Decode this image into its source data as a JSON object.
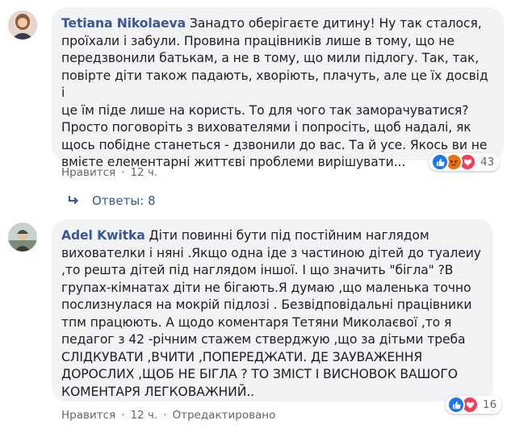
{
  "comments": [
    {
      "author": "Tetiana Nikolaeva",
      "lines": [
        "Занадто оберігаєте дитину! Ну так сталося,",
        "проїхали і забули. Провина працівників лише в тому, що не",
        "передзвонили батькам, а не в тому, що мили підлогу. Так, так,",
        "повірте діти також падають, хворіють, плачуть, але це їх досвід і",
        "це їм піде лише на користь. То для чого так заморачуватися?",
        "Просто поговоріть з вихователями і попросіть, щоб надалі, як",
        "щось побідне станеться - дзвонили до вас. Та й усе. Якось ви не",
        "вмієте елементарні життєві проблеми вирішувати..."
      ],
      "like_label": "Нравится",
      "time": "12 ч.",
      "reaction_count": "43",
      "reactions": [
        "like-icon",
        "angry-icon",
        "love-icon"
      ]
    },
    {
      "author": "Adel Kwitka",
      "lines": [
        "Діти повинні бути під постійним наглядом",
        "вихователки і няні .Якщо одна іде з частиною дітей до туалеиу",
        ",то решта дітей під наглядом іншої. І що значить \"бігла\" ?В",
        "групах-кімнатах діти не бігають.Я думаю ,що маленька точно",
        "послизнулася на мокрій підлозі . Безвідповідальні працівники",
        "тпм працюють. А щодо коментаря Тетяни Миколаєвої ,то я",
        "педагог з 42 -річним стажем стверджую ,що за дітьми треба",
        "СЛІДКУВАТИ ,ВЧИТИ ,ПОПЕРЕДЖАТИ. ДЕ ЗАУВАЖЕННЯ",
        "ДОРОСЛИХ ,ЩОБ НЕ БІГЛА ? ТО ЗМІСТ І ВИСНОВОК ВАШОГО",
        "КОМЕНТАРЯ ЛЕГКОВАЖНИЙ.."
      ],
      "like_label": "Нравится",
      "time": "12 ч.",
      "edited_label": "Отредактировано",
      "reaction_count": "16",
      "reactions": [
        "like-icon",
        "love-icon"
      ]
    }
  ],
  "replies_label": "Ответы: 8",
  "colors": {
    "link": "#385898",
    "bubble": "#f2f3f5",
    "meta": "#606770",
    "like": "#1877f2",
    "love": "#f33e58",
    "angry": "#e9710f"
  }
}
